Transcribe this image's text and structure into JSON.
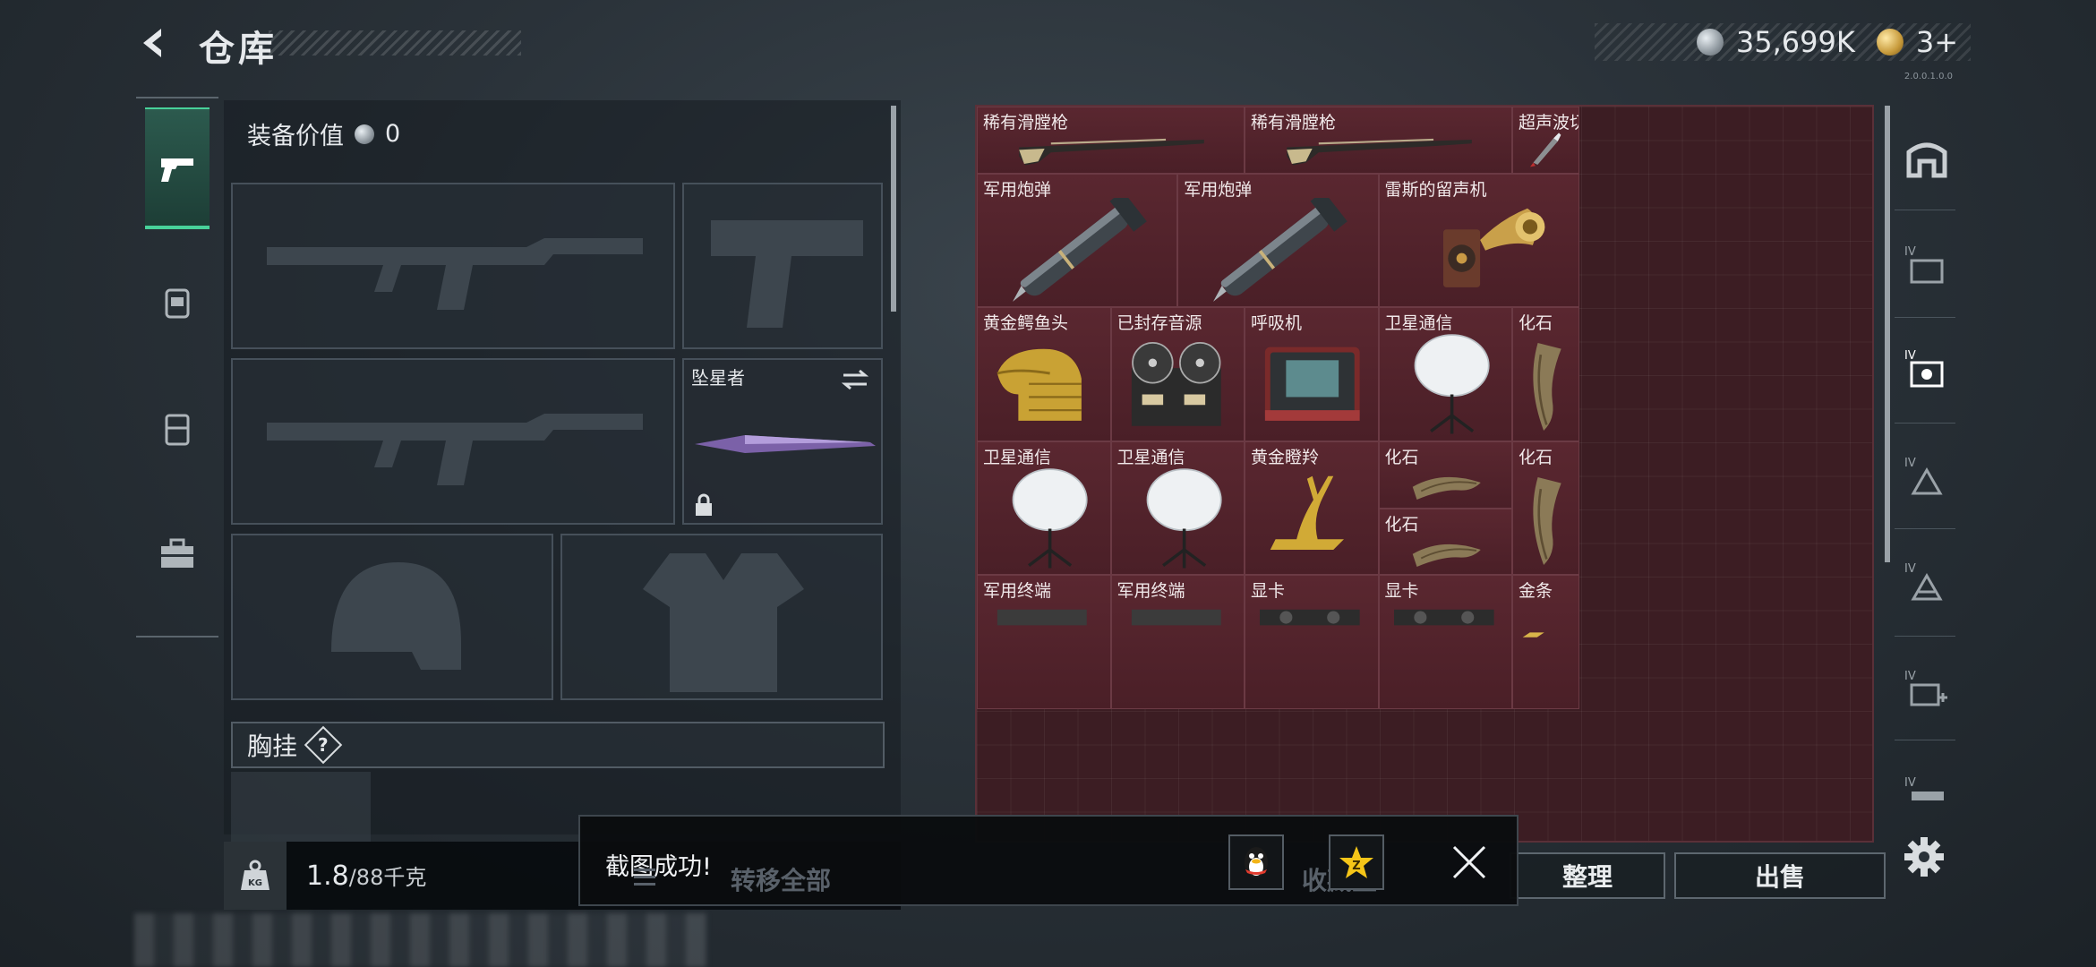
{
  "header": {
    "title": "仓库",
    "currency_silver": "35,699K",
    "currency_gold": "3+",
    "version_text": "2.0.0.1.0.0"
  },
  "equipment": {
    "value_label": "装备价值",
    "value": "0",
    "melee_name": "坠星者",
    "chest_rig_label": "胸挂",
    "help_mark": "?"
  },
  "weight": {
    "current": "1.8",
    "max": "/88千克",
    "icon_text": "KG"
  },
  "warehouse": {
    "items": [
      {
        "name": "稀有滑膛枪",
        "icon": "musket"
      },
      {
        "name": "稀有滑膛枪",
        "icon": "musket"
      },
      {
        "name": "超声波切...",
        "icon": "ultrasonic-cutter"
      },
      {
        "name": "军用炮弹",
        "icon": "artillery-shell"
      },
      {
        "name": "军用炮弹",
        "icon": "artillery-shell"
      },
      {
        "name": "雷斯的留声机",
        "icon": "gramophone"
      },
      {
        "name": "黄金鳄鱼头",
        "icon": "golden-crocodile-head"
      },
      {
        "name": "已封存音源",
        "icon": "reel-recorder"
      },
      {
        "name": "呼吸机",
        "icon": "ventilator"
      },
      {
        "name": "卫星通信",
        "icon": "satellite-dish"
      },
      {
        "name": "化石",
        "icon": "fossil-claw"
      },
      {
        "name": "卫星通信",
        "icon": "satellite-dish"
      },
      {
        "name": "卫星通信",
        "icon": "satellite-dish"
      },
      {
        "name": "黄金瞪羚",
        "icon": "golden-gazelle"
      },
      {
        "name": "化石",
        "icon": "fossil-claw"
      },
      {
        "name": "化石",
        "icon": "fossil-claw"
      },
      {
        "name": "化石",
        "icon": "fossil-claw"
      },
      {
        "name": "军用终端",
        "icon": "terminal"
      },
      {
        "name": "军用终端",
        "icon": "terminal"
      },
      {
        "name": "显卡",
        "icon": "graphics-card"
      },
      {
        "name": "显卡",
        "icon": "graphics-card"
      },
      {
        "name": "金条",
        "icon": "gold-bar"
      }
    ]
  },
  "buttons": {
    "transfer_all": "转移全部",
    "collect": "收藏室",
    "organize": "整理",
    "sell": "出售"
  },
  "toast": {
    "message": "截图成功!"
  },
  "colors": {
    "accent_green": "#48d19a",
    "item_bg_red": "#4a1f27"
  }
}
